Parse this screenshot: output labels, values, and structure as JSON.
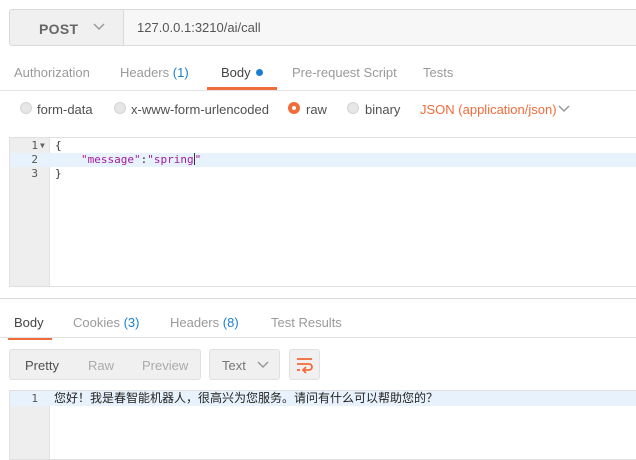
{
  "request": {
    "method": "POST",
    "url": "127.0.0.1:3210/ai/call"
  },
  "request_tabs": [
    {
      "label": "Authorization"
    },
    {
      "label": "Headers",
      "count": "(1)"
    },
    {
      "label": "Body",
      "active": true
    },
    {
      "label": "Pre-request Script"
    },
    {
      "label": "Tests"
    }
  ],
  "body_types": [
    {
      "label": "form-data"
    },
    {
      "label": "x-www-form-urlencoded"
    },
    {
      "label": "raw",
      "selected": true
    },
    {
      "label": "binary"
    }
  ],
  "content_type": "JSON (application/json)",
  "request_body": {
    "lines": [
      {
        "num": "1",
        "text": "{"
      },
      {
        "num": "2",
        "key": "\"message\"",
        "sep": ":",
        "value": "\"spring\""
      },
      {
        "num": "3",
        "text": "}"
      }
    ]
  },
  "response_tabs": [
    {
      "label": "Body",
      "active": true
    },
    {
      "label": "Cookies",
      "count": "(3)"
    },
    {
      "label": "Headers",
      "count": "(8)"
    },
    {
      "label": "Test Results"
    }
  ],
  "view_modes": [
    "Pretty",
    "Raw",
    "Preview"
  ],
  "format": "Text",
  "response_body": {
    "lines": [
      {
        "num": "1",
        "text": "您好！我是春智能机器人，很高兴为您服务。请问有什么可以帮助您的？"
      }
    ]
  },
  "colors": {
    "accent": "#f26b3a",
    "count_blue": "#1b7fd1"
  }
}
